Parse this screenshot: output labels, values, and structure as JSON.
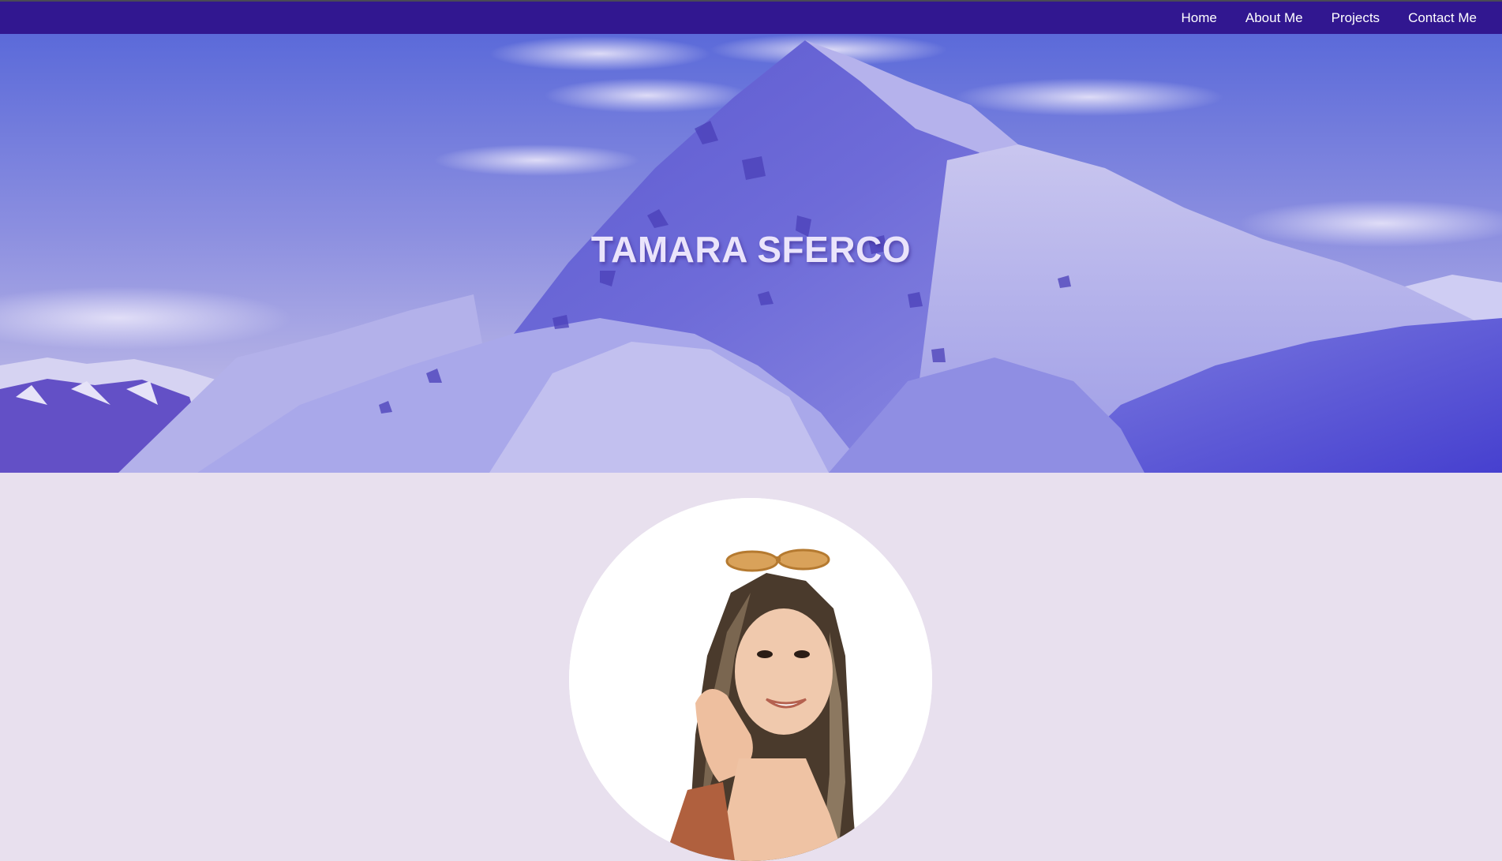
{
  "nav": {
    "items": [
      {
        "label": "Home"
      },
      {
        "label": "About Me"
      },
      {
        "label": "Projects"
      },
      {
        "label": "Contact Me"
      }
    ]
  },
  "hero": {
    "title": "TAMARA SFERCO"
  },
  "colors": {
    "navbar": "#311790",
    "page_background": "#e8e0ee",
    "nav_text": "#ffffff",
    "hero_title": "#eae4fb"
  },
  "icons": {
    "hero_background": "mountain-illustration",
    "profile": "profile-photo"
  }
}
